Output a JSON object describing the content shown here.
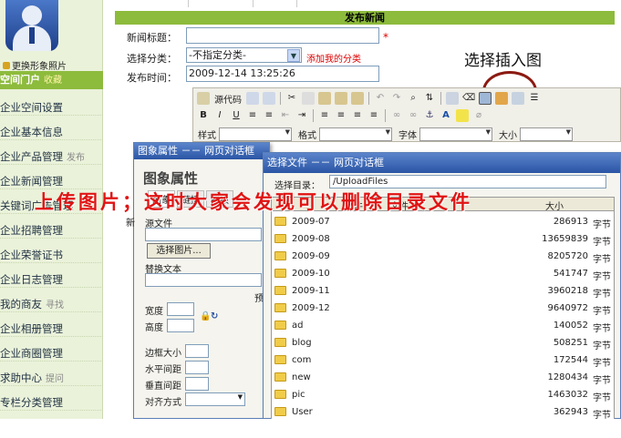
{
  "sidebar": {
    "photo_link": "更换形象照片",
    "portal": "空间门户",
    "portal_sub": "收藏",
    "items": [
      {
        "label": "企业空间设置",
        "sub": ""
      },
      {
        "label": "企业基本信息",
        "sub": ""
      },
      {
        "label": "企业产品管理",
        "sub": "发布"
      },
      {
        "label": "企业新闻管理",
        "sub": ""
      },
      {
        "label": "关键词广告管理",
        "sub": ""
      },
      {
        "label": "企业招聘管理",
        "sub": ""
      },
      {
        "label": "企业荣誉证书",
        "sub": ""
      },
      {
        "label": "企业日志管理",
        "sub": ""
      },
      {
        "label": "我的商友",
        "sub": "寻找"
      },
      {
        "label": "企业相册管理",
        "sub": ""
      },
      {
        "label": "企业商圈管理",
        "sub": ""
      },
      {
        "label": "求助中心",
        "sub": "提问"
      },
      {
        "label": "专栏分类管理",
        "sub": ""
      }
    ]
  },
  "form": {
    "header": "发布新闻",
    "title_label": "新闻标题：",
    "category_label": "选择分类：",
    "category_value": "-不指定分类-",
    "add_category": "添加我的分类",
    "time_label": "发布时间：",
    "time_value": "2009-12-14 13:25:26",
    "required_mark": "*"
  },
  "annotation": "选择插入图",
  "overlay_text": "上传图片；这时大家会发现可以删除目录文件",
  "editor": {
    "source_label": "源代码",
    "style_label": "样式",
    "format_label": "格式",
    "font_label": "字体",
    "size_label": "大小"
  },
  "image_dialog": {
    "title": "图象属性 －－ 网页对话框",
    "heading": "图象属性",
    "tabs": [
      "图象",
      "链接",
      "高级"
    ],
    "source_label": "源文件",
    "choose_button": "选择图片...",
    "alt_label": "替换文本",
    "preview_label": "预",
    "width_label": "宽度",
    "height_label": "高度",
    "border_label": "边框大小",
    "hspace_label": "水平间距",
    "vspace_label": "垂直间距",
    "align_label": "对齐方式",
    "left_partial": "新"
  },
  "file_dialog": {
    "title": "选择文件 －－ 网页对话框",
    "dir_label": "选择目录：",
    "dir_value": "/UploadFiles",
    "col_file": "文件",
    "col_size": "大小",
    "col_mid": "文件",
    "rows": [
      {
        "name": "2009-07",
        "size": "286913",
        "unit": "字节"
      },
      {
        "name": "2009-08",
        "size": "13659839",
        "unit": "字节"
      },
      {
        "name": "2009-09",
        "size": "8205720",
        "unit": "字节"
      },
      {
        "name": "2009-10",
        "size": "541747",
        "unit": "字节"
      },
      {
        "name": "2009-11",
        "size": "3960218",
        "unit": "字节"
      },
      {
        "name": "2009-12",
        "size": "9640972",
        "unit": "字节"
      },
      {
        "name": "ad",
        "size": "140052",
        "unit": "字节"
      },
      {
        "name": "blog",
        "size": "508251",
        "unit": "字节"
      },
      {
        "name": "com",
        "size": "172544",
        "unit": "字节"
      },
      {
        "name": "new",
        "size": "1280434",
        "unit": "字节"
      },
      {
        "name": "pic",
        "size": "1463032",
        "unit": "字节"
      },
      {
        "name": "User",
        "size": "362943",
        "unit": "字节"
      }
    ]
  },
  "colors": {
    "accent": "#8dbb3c",
    "annotation_circle": "#8b1a12",
    "overlay": "#e01414"
  }
}
